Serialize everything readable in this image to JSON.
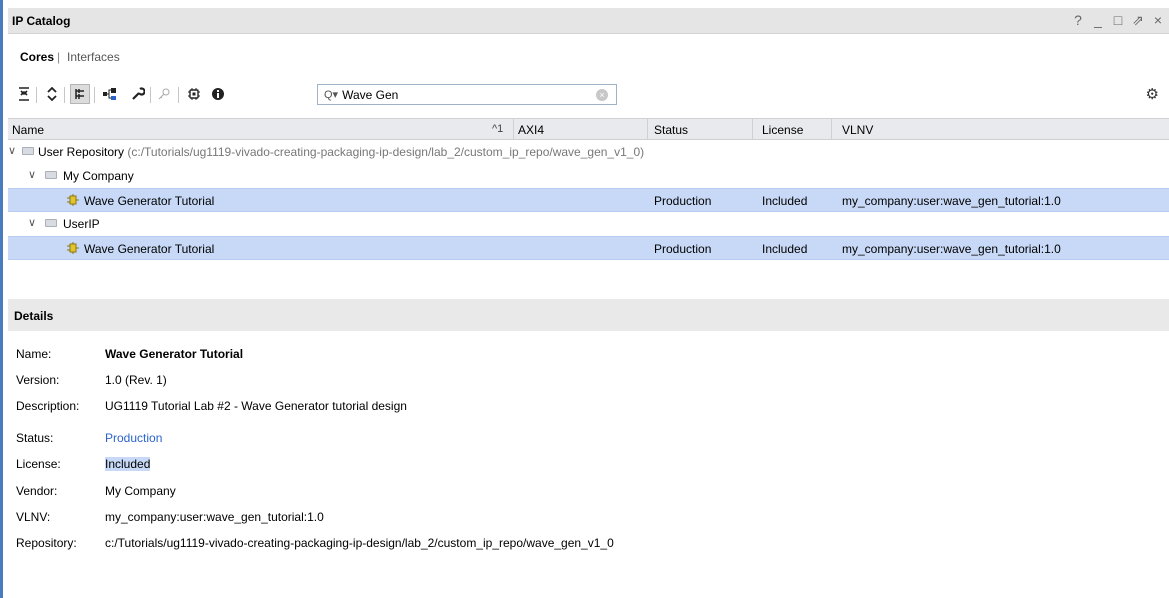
{
  "window": {
    "title": "IP Catalog",
    "controls": [
      "?",
      "_",
      "□",
      "⇗",
      "×"
    ]
  },
  "tabs": {
    "cores": "Cores",
    "separator": "|",
    "interfaces": "Interfaces"
  },
  "toolbar": {
    "icons": [
      "collapse-all-icon",
      "expand-all-icon",
      "group-icon",
      "hierarchy-icon",
      "wrench-icon",
      "key-icon",
      "chip-icon",
      "info-icon",
      "settings-gear-icon"
    ],
    "search_value": "Wave Gen"
  },
  "table": {
    "columns": [
      "Name",
      "AXI4",
      "Status",
      "License",
      "VLNV"
    ],
    "sort_indicator": "^1",
    "repository": {
      "label": "User Repository",
      "path": "(c:/Tutorials/ug1119-vivado-creating-packaging-ip-design/lab_2/custom_ip_repo/wave_gen_v1_0)"
    },
    "groups": [
      {
        "name": "My Company",
        "item": {
          "name": "Wave Generator Tutorial",
          "axi4": "",
          "status": "Production",
          "license": "Included",
          "vlnv": "my_company:user:wave_gen_tutorial:1.0"
        }
      },
      {
        "name": "UserIP",
        "item": {
          "name": "Wave Generator Tutorial",
          "axi4": "",
          "status": "Production",
          "license": "Included",
          "vlnv": "my_company:user:wave_gen_tutorial:1.0"
        }
      }
    ]
  },
  "details": {
    "title": "Details",
    "fields": [
      {
        "key": "Name:",
        "value": "Wave Generator Tutorial"
      },
      {
        "key": "Version:",
        "value": "1.0 (Rev. 1)"
      },
      {
        "key": "Description:",
        "value": "UG1119 Tutorial Lab #2 - Wave Generator tutorial design"
      },
      {
        "key": "Status:",
        "value": "Production"
      },
      {
        "key": "License:",
        "value": "Included"
      },
      {
        "key": "Vendor:",
        "value": "My Company"
      },
      {
        "key": "VLNV:",
        "value": "my_company:user:wave_gen_tutorial:1.0"
      },
      {
        "key": "Repository:",
        "value": "c:/Tutorials/ug1119-vivado-creating-packaging-ip-design/lab_2/custom_ip_repo/wave_gen_v1_0"
      }
    ]
  },
  "colors": {
    "selection": "#c7d9f6",
    "link": "#2a63c9",
    "header_bg": "#e8eaed"
  }
}
